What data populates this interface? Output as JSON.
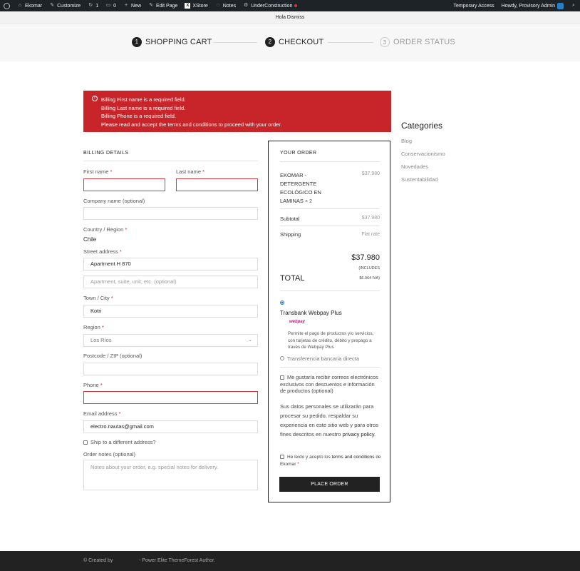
{
  "adminbar": {
    "site": "Ekomar",
    "customize": "Customize",
    "updates_count": "1",
    "comments_count": "0",
    "new": "New",
    "edit_page": "Edit Page",
    "xstore": "XStore",
    "notes": "Notes",
    "under_construction": "UnderConstruction",
    "temporary_access": "Temporary Access",
    "howdy": "Howdy, Provisory Admin"
  },
  "top_notice": "Hola Dismiss",
  "steps": [
    {
      "num": "1",
      "label": "SHOPPING CART"
    },
    {
      "num": "2",
      "label": "CHECKOUT"
    },
    {
      "num": "3",
      "label": "ORDER STATUS"
    }
  ],
  "errors": [
    "Billing First name is a required field.",
    "Billing Last name is a required field.",
    "Billing Phone is a required field.",
    "Please read and accept the terms and conditions to proceed with your order."
  ],
  "billing": {
    "title": "BILLING DETAILS",
    "first_name_label": "First name",
    "last_name_label": "Last name",
    "company_label": "Company name (optional)",
    "country_label": "Country / Region",
    "country_value": "Chile",
    "street_label": "Street address",
    "street_value": "Apartment H 870",
    "street2_placeholder": "Apartment, suite, unit, etc. (optional)",
    "city_label": "Town / City",
    "city_value": "Kotri",
    "region_label": "Region",
    "region_value": "Los Ríos",
    "postcode_label": "Postcode / ZIP (optional)",
    "phone_label": "Phone",
    "email_label": "Email address",
    "email_value": "electro.nautas@gmail.com",
    "ship_different": "Ship to a different address?",
    "notes_label": "Order notes (optional)",
    "notes_placeholder": "Notes about your order, e.g. special notes for delivery.",
    "required_mark": "*"
  },
  "order": {
    "title": "YOUR ORDER",
    "product_name": "EKOMAR - DETERGENTE ECOLÓGICO EN LAMINAS",
    "product_qty": "× 2",
    "product_price": "$37.980",
    "subtotal_label": "Subtotal",
    "subtotal_value": "$37.980",
    "shipping_label": "Shipping",
    "shipping_value": "Flat rate",
    "total_label": "TOTAL",
    "total_value": "$37.980",
    "includes": "(INCLUDES",
    "iva": "$6.064 IVA)",
    "payment_transbank": "Transbank Webpay Plus",
    "webpay_logo": "webpay",
    "webpay_desc": "Permite el pago de productos y/o servicios, con tarjetas de crédito, débito y prepago a través de Webpay Plus",
    "payment_transfer": "Transferencia bancaria directa",
    "newsletter": "Me gustaría recibir correos electrónicos exclusivos con descuentos e información de productos (optional)",
    "privacy_text": "Sus datos personales se utilizarán para procesar su pedido, respaldar su experiencia en este sitio web y para otros fines descritos en nuestro",
    "privacy_link": "privacy policy.",
    "terms_text": "He leído y acepto los",
    "terms_link": "terms and conditions",
    "terms_end": "de Ekomar",
    "place_order": "PLACE ORDER"
  },
  "sidebar": {
    "title": "Categories",
    "items": [
      "Blog",
      "Conservacionismo",
      "Novedades",
      "Sustentabilidad"
    ]
  },
  "footer": {
    "created_by": "© Created by",
    "author": "- Power Elite ThemeForest Author."
  },
  "colors": {
    "error_bg": "#c8252a",
    "admin_bar": "#1d2327",
    "dark": "#222222",
    "radio_accent": "#2a7ec4"
  }
}
